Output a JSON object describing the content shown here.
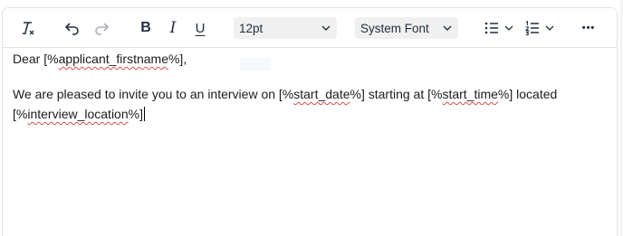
{
  "toolbar": {
    "clear_formatting_icon": "clear-formatting-icon",
    "bold_label": "B",
    "italic_label": "I",
    "underline_label": "U",
    "font_size": "12pt",
    "font_family": "System Font",
    "more_label": "•••"
  },
  "content": {
    "line1": {
      "prefix": "Dear [%",
      "var": "applicant_firstname",
      "suffix": "%],"
    },
    "line2": {
      "t1": "We are pleased to invite you to an interview on [%",
      "v1": "start_date",
      "t2": "%] starting at [%",
      "v2": "start_time",
      "t3": "%] located"
    },
    "line3": {
      "t1": "[%",
      "v1": "interview_location",
      "t2": "%]"
    }
  },
  "colors": {
    "spellcheck": "#d94c4c",
    "border": "#dfe1e5",
    "select_bg": "#f0f0f0",
    "icon": "#222f3e"
  }
}
